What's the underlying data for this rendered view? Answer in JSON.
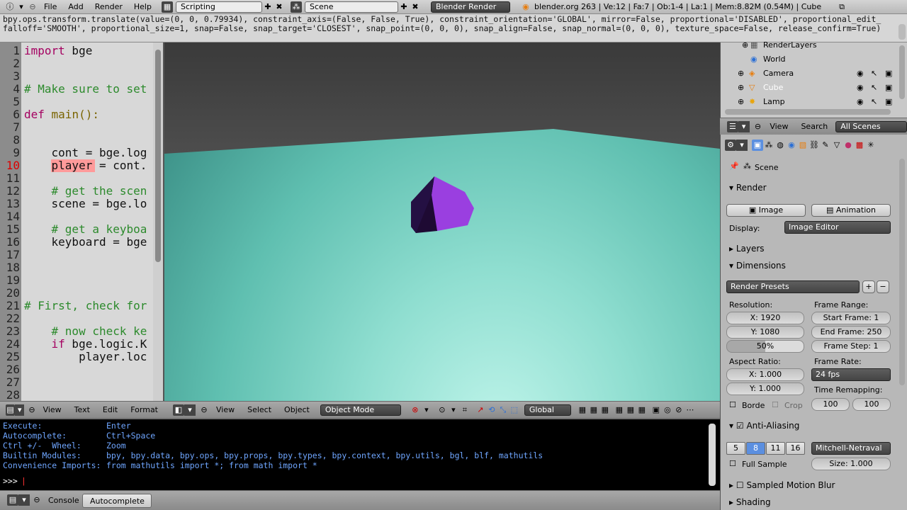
{
  "topbar": {
    "menus": [
      "File",
      "Add",
      "Render",
      "Help"
    ],
    "screen_layout": "Scripting",
    "scene": "Scene",
    "engine": "Blender Render",
    "stats": "blender.org 263 | Ve:12 | Fa:7 | Ob:1-4 | La:1 | Mem:8.82M (0.54M) | Cube"
  },
  "report": {
    "line1": "bpy.ops.transform.translate(value=(0, 0, 0.79934), constraint_axis=(False, False, True), constraint_orientation='GLOBAL', mirror=False, proportional='DISABLED', proportional_edit_",
    "line2": "falloff='SMOOTH', proportional_size=1, snap=False, snap_target='CLOSEST', snap_point=(0, 0, 0), snap_align=False, snap_normal=(0, 0, 0), texture_space=False, release_confirm=True)"
  },
  "text_editor": {
    "lines": [
      {
        "n": "1",
        "text": "import bge",
        "kind": "import"
      },
      {
        "n": "2",
        "text": "",
        "kind": "plain"
      },
      {
        "n": "3",
        "text": "",
        "kind": "plain"
      },
      {
        "n": "4",
        "text": "# Make sure to set",
        "kind": "comment"
      },
      {
        "n": "5",
        "text": "",
        "kind": "plain"
      },
      {
        "n": "6",
        "text": "def main():",
        "kind": "def"
      },
      {
        "n": "7",
        "text": "",
        "kind": "plain"
      },
      {
        "n": "8",
        "text": "",
        "kind": "plain"
      },
      {
        "n": "9",
        "text": "    cont = bge.log",
        "kind": "plain"
      },
      {
        "n": "10",
        "text": "    player = cont.",
        "kind": "current"
      },
      {
        "n": "11",
        "text": "",
        "kind": "plain"
      },
      {
        "n": "12",
        "text": "    # get the scen",
        "kind": "comment"
      },
      {
        "n": "13",
        "text": "    scene = bge.lo",
        "kind": "plain"
      },
      {
        "n": "14",
        "text": "",
        "kind": "plain"
      },
      {
        "n": "15",
        "text": "    # get a keyboa",
        "kind": "comment"
      },
      {
        "n": "16",
        "text": "    keyboard = bge",
        "kind": "plain"
      },
      {
        "n": "17",
        "text": "",
        "kind": "plain"
      },
      {
        "n": "18",
        "text": "",
        "kind": "plain"
      },
      {
        "n": "19",
        "text": "",
        "kind": "plain"
      },
      {
        "n": "20",
        "text": "",
        "kind": "plain"
      },
      {
        "n": "21",
        "text": "# First, check for",
        "kind": "comment"
      },
      {
        "n": "22",
        "text": "",
        "kind": "plain"
      },
      {
        "n": "23",
        "text": "    # now check ke",
        "kind": "comment"
      },
      {
        "n": "24",
        "text": "    if bge.logic.K",
        "kind": "if"
      },
      {
        "n": "25",
        "text": "        player.loc",
        "kind": "plain"
      },
      {
        "n": "26",
        "text": "",
        "kind": "plain"
      },
      {
        "n": "27",
        "text": "",
        "kind": "plain"
      },
      {
        "n": "28",
        "text": "",
        "kind": "plain"
      }
    ],
    "header_menus": [
      "View",
      "Text",
      "Edit",
      "Format"
    ]
  },
  "viewport": {
    "header_menus": [
      "View",
      "Select",
      "Object"
    ],
    "mode": "Object Mode",
    "orientation": "Global"
  },
  "console": {
    "lines": [
      {
        "label": "Execute:",
        "value": "Enter"
      },
      {
        "label": "Autocomplete:",
        "value": "Ctrl+Space"
      },
      {
        "label": "Ctrl +/-  Wheel:",
        "value": "Zoom"
      },
      {
        "label": "Builtin Modules:",
        "value": "bpy, bpy.data, bpy.ops, bpy.props, bpy.types, bpy.context, bpy.utils, bgl, blf, mathutils"
      },
      {
        "label": "Convenience Imports:",
        "value": "from mathutils import *; from math import *"
      }
    ],
    "prompt": ">>> ",
    "tabs": [
      "Console",
      "Autocomplete"
    ]
  },
  "outliner": {
    "items": [
      "RenderLayers",
      "World",
      "Camera",
      "Cube",
      "Lamp"
    ],
    "header_menus": [
      "View",
      "Search"
    ],
    "filter": "All Scenes"
  },
  "properties": {
    "scene_label": "Scene",
    "render_panel": "Render",
    "image_btn": "Image",
    "animation_btn": "Animation",
    "display_label": "Display:",
    "display_value": "Image Editor",
    "layers_panel": "Layers",
    "dimensions_panel": "Dimensions",
    "render_presets": "Render Presets",
    "resolution_label": "Resolution:",
    "res_x": "X: 1920",
    "res_y": "Y: 1080",
    "res_pct": "50%",
    "frame_range_label": "Frame Range:",
    "start_frame": "Start Frame: 1",
    "end_frame": "End Frame: 250",
    "frame_step": "Frame Step: 1",
    "aspect_label": "Aspect Ratio:",
    "aspect_x": "X: 1.000",
    "aspect_y": "Y: 1.000",
    "frame_rate_label": "Frame Rate:",
    "fps": "24 fps",
    "time_remap_label": "Time Remapping:",
    "remap_old": "100",
    "remap_new": "100",
    "border_label": "Borde",
    "crop_label": "Crop",
    "antialiasing_panel": "Anti-Aliasing",
    "aa_samples": [
      "5",
      "8",
      "11",
      "16"
    ],
    "aa_filter": "Mitchell-Netraval",
    "full_sample_label": "Full Sample",
    "aa_size": "Size: 1.000",
    "motion_blur_panel": "Sampled Motion Blur",
    "shading_panel": "Shading"
  },
  "colors": {
    "highlight_line": "#ff9a9a",
    "selected_sample": "#5b8fe0",
    "console_text": "#6fa6ff"
  }
}
